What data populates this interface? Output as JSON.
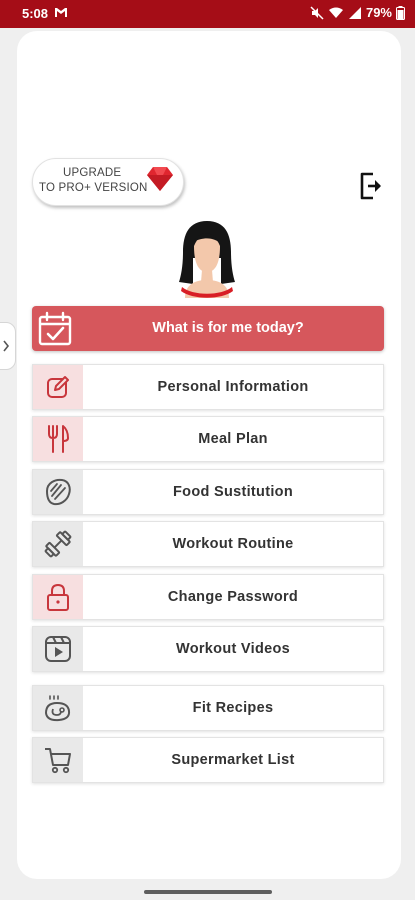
{
  "status_bar": {
    "time": "5:08",
    "battery": "79%",
    "icons": [
      "gmail-icon",
      "mute-icon",
      "wifi-icon",
      "signal-icon",
      "battery-icon"
    ]
  },
  "upgrade_button": {
    "line1": "UPGRADE",
    "line2": "TO PRO+ VERSION",
    "icon": "ruby-gem-icon"
  },
  "logout_icon": "logout-icon",
  "avatar_icon": "female-avatar-icon",
  "today_banner": {
    "label": "What is for me today?",
    "icon": "calendar-check-icon"
  },
  "menu": {
    "items": [
      {
        "label": "Personal Information",
        "icon": "edit-icon"
      },
      {
        "label": "Meal Plan",
        "icon": "fork-knife-icon"
      },
      {
        "label": "Food Sustitution",
        "icon": "steak-icon"
      },
      {
        "label": "Workout Routine",
        "icon": "dumbbell-icon"
      },
      {
        "label": "Change Password",
        "icon": "lock-icon"
      },
      {
        "label": "Workout Videos",
        "icon": "video-player-icon"
      },
      {
        "label": "Fit Recipes",
        "icon": "roast-chicken-icon"
      },
      {
        "label": "Supermarket List",
        "icon": "shopping-cart-icon"
      }
    ]
  },
  "colors": {
    "status_bar": "#a50d17",
    "accent": "#d6575c",
    "icon_red": "#c8363c",
    "icon_grey": "#555555"
  }
}
